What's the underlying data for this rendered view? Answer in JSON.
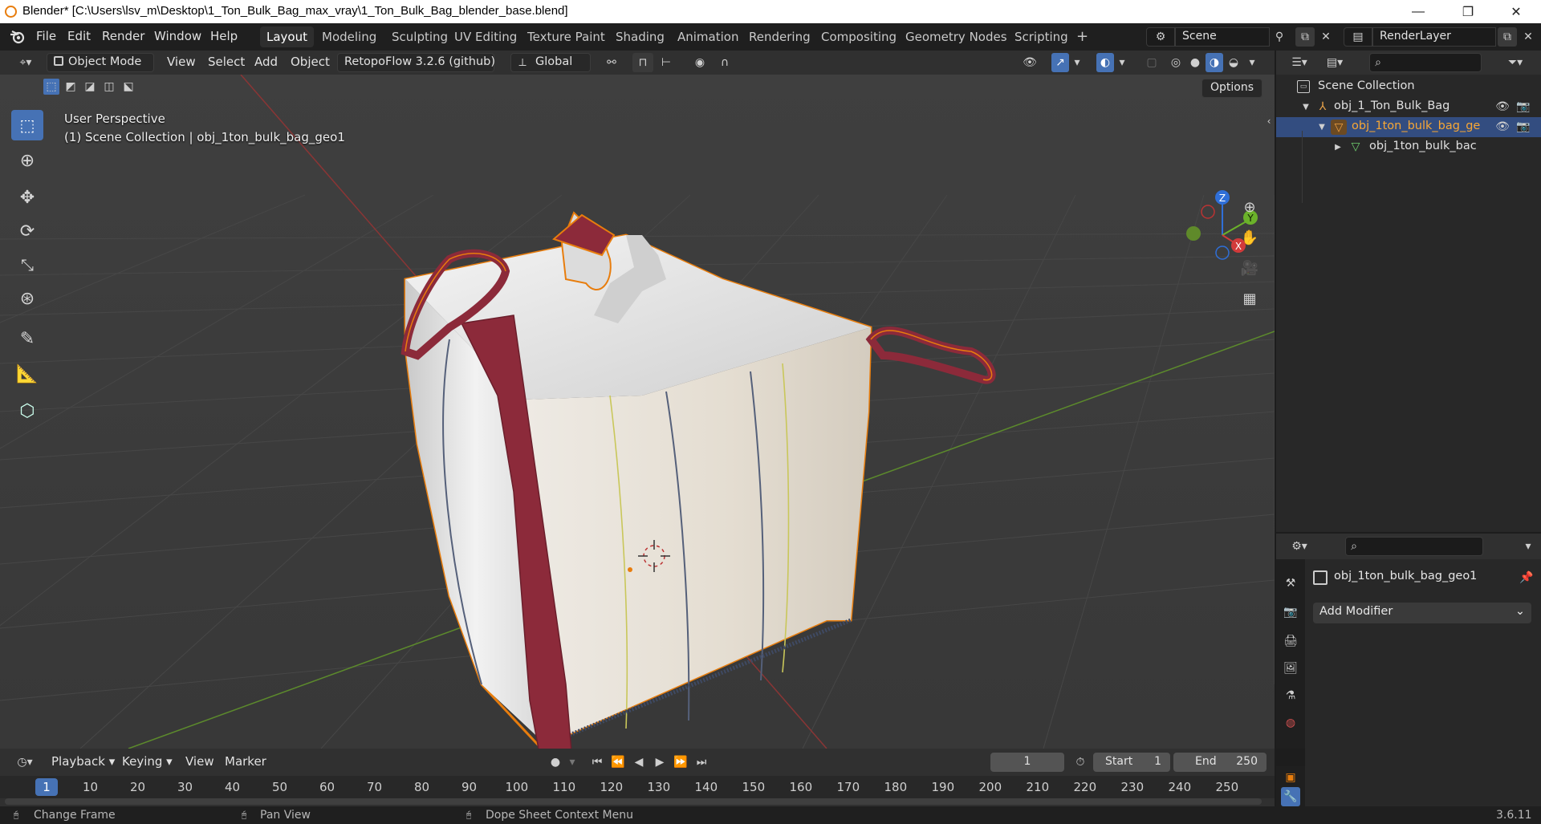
{
  "window": {
    "title": "Blender* [C:\\Users\\lsv_m\\Desktop\\1_Ton_Bulk_Bag_max_vray\\1_Ton_Bulk_Bag_blender_base.blend]",
    "minimize": "—",
    "maximize": "❐",
    "close": "✕"
  },
  "menu": [
    "File",
    "Edit",
    "Render",
    "Window",
    "Help"
  ],
  "workspaces": [
    "Layout",
    "Modeling",
    "Sculpting",
    "UV Editing",
    "Texture Paint",
    "Shading",
    "Animation",
    "Rendering",
    "Compositing",
    "Geometry Nodes",
    "Scripting"
  ],
  "active_workspace": "Layout",
  "add_workspace": "+",
  "scene": {
    "label": "Scene"
  },
  "render_layer": {
    "label": "RenderLayer"
  },
  "header3d": {
    "mode": "Object Mode",
    "view": "View",
    "select": "Select",
    "add": "Add",
    "object": "Object",
    "addon": "RetopoFlow 3.2.6 (github)",
    "orientation": "Global"
  },
  "viewport": {
    "perspective": "User Perspective",
    "collection": "(1) Scene Collection | obj_1ton_bulk_bag_geo1",
    "options": "Options",
    "gizmo": {
      "x": "X",
      "y": "Y",
      "z": "Z"
    }
  },
  "outliner": {
    "scene_collection": "Scene Collection",
    "items": [
      {
        "label": "obj_1_Ton_Bulk_Bag",
        "icon": "empty-icon"
      },
      {
        "label": "obj_1ton_bulk_bag_ge",
        "icon": "mesh-object-icon"
      },
      {
        "label": "obj_1ton_bulk_bac",
        "icon": "mesh-data-icon"
      }
    ]
  },
  "properties": {
    "object_name": "obj_1ton_bulk_bag_geo1",
    "add_modifier": "Add Modifier"
  },
  "timeline": {
    "playback": "Playback",
    "keying": "Keying",
    "view": "View",
    "marker": "Marker",
    "current_frame": "1",
    "start_label": "Start",
    "start": "1",
    "end_label": "End",
    "end": "250",
    "frame_marker": "1",
    "frames": [
      "10",
      "20",
      "30",
      "40",
      "50",
      "60",
      "70",
      "80",
      "90",
      "100",
      "110",
      "120",
      "130",
      "140",
      "150",
      "160",
      "170",
      "180",
      "190",
      "200",
      "210",
      "220",
      "230",
      "240",
      "250"
    ]
  },
  "status": {
    "change_frame": "Change Frame",
    "pan_view": "Pan View",
    "context_menu": "Dope Sheet Context Menu",
    "version": "3.6.11"
  },
  "colors": {
    "accent": "#4672b5",
    "selection": "#e87d0d",
    "strap": "#8c2a3a"
  }
}
